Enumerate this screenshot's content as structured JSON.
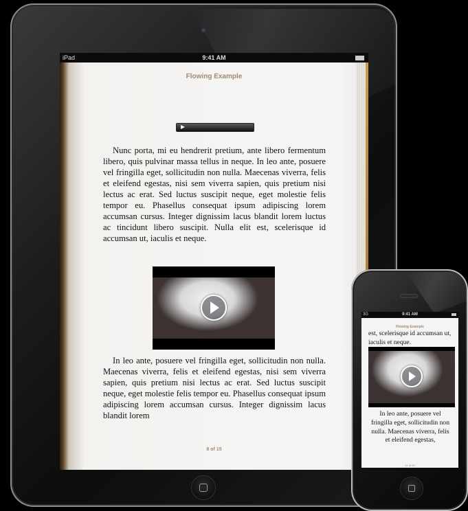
{
  "ipad": {
    "status": {
      "device": "iPad",
      "time": "9:41 AM"
    },
    "book_title": "Flowing Example",
    "paragraph1": "Nunc porta, mi eu hendrerit pretium, ante libero fermentum libero, quis pulvinar massa tellus in neque. In leo ante, posuere vel fringilla eget, sollicitudin non nulla. Maecenas viverra, felis et eleifend egestas, nisi sem viverra sapien, quis pretium nisi lectus ac erat. Sed luctus suscipit neque, eget molestie felis tempor eu. Phasellus consequat ipsum adipiscing lorem accumsan cursus. Integer dignissim lacus blandit lorem luctus ac tincidunt libero suscipit. Nulla elit est, scelerisque id accumsan ut, iaculis et neque.",
    "paragraph2": "In leo ante, posuere vel fringilla eget, sollicitudin non nulla. Maecenas viverra, felis et eleifend egestas, nisi sem viverra sapien, quis pretium nisi lectus ac erat. Sed luctus suscipit neque, eget molestie felis tempor eu. Phasellus consequat ipsum adipiscing lorem accumsan cursus. Integer dignissim lacus blandit lorem",
    "page_indicator": "8 of 15"
  },
  "iphone": {
    "status": {
      "carrier": "3G",
      "time": "9:41 AM"
    },
    "book_title": "Flowing Example",
    "paragraph1": "est, scelerisque id accumsan ut, iaculis et neque.",
    "paragraph2": "In leo ante, posuere vel fringilla eget, sollicitudin non nulla. Maecenas viverra, felis et eleifend egestas,",
    "page_indicator": "31 of 42"
  },
  "icons": {
    "play": "play-icon",
    "wifi": "wifi-icon",
    "battery": "battery-icon",
    "home": "home-button-icon"
  }
}
